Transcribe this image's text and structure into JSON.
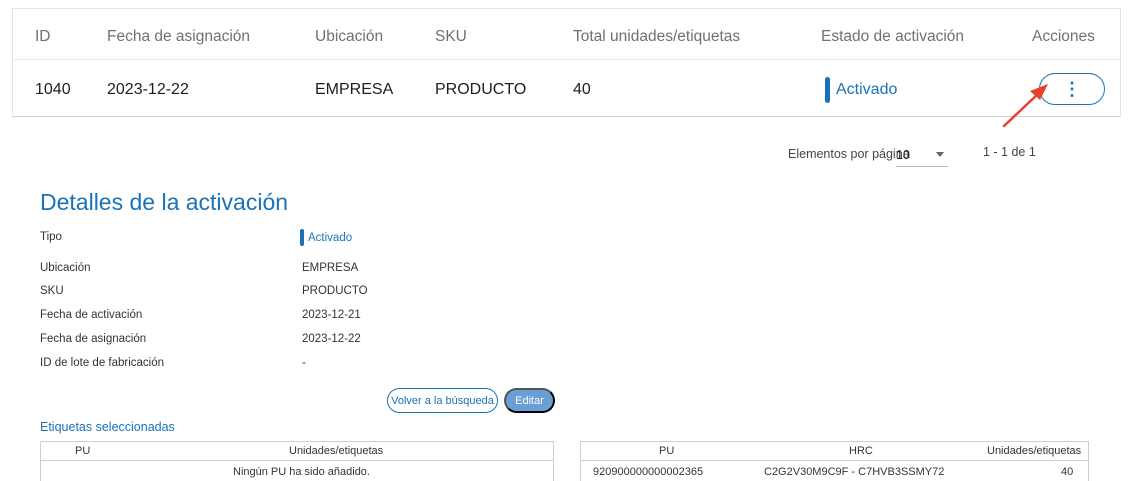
{
  "table": {
    "headers": [
      "ID",
      "Fecha de asignación",
      "Ubicación",
      "SKU",
      "Total unidades/etiquetas",
      "Estado de activación",
      "Acciones"
    ],
    "row": {
      "id": "1040",
      "fecha_asignacion": "2023-12-22",
      "ubicacion": "EMPRESA",
      "sku": "PRODUCTO",
      "total": "40",
      "estado": "Activado",
      "actions_icon": "⋮"
    }
  },
  "pagination": {
    "label": "Elementos por página",
    "per_page": "10",
    "range": "1 - 1 de 1"
  },
  "details": {
    "title": "Detalles de la activación",
    "fields": [
      {
        "label": "Tipo",
        "value": "Activado"
      },
      {
        "label": "Ubicación",
        "value": "EMPRESA"
      },
      {
        "label": "SKU",
        "value": "PRODUCTO"
      },
      {
        "label": "Fecha de activación",
        "value": "2023-12-21"
      },
      {
        "label": "Fecha de asignación",
        "value": "2023-12-22"
      },
      {
        "label": "ID de lote de fabricación",
        "value": "-"
      }
    ],
    "back_button": "Volver a la búsqueda",
    "edit_button": "Editar"
  },
  "selected": {
    "title": "Etiquetas seleccionadas",
    "left_table": {
      "headers": [
        "PU",
        "Unidades/etiquetas"
      ],
      "empty_message": "Ningún PU ha sido añadido."
    },
    "right_table": {
      "headers": [
        "PU",
        "HRC",
        "Unidades/etiquetas"
      ],
      "rows": [
        {
          "pu": "920900000000002365",
          "hrc": "C2G2V30M9C9F - C7HVB3SSMY72",
          "units": "40"
        }
      ]
    }
  },
  "colors": {
    "accent": "#1a73b8",
    "edit_button": "#6a9fd6",
    "annotation_arrow": "#e8402b"
  }
}
